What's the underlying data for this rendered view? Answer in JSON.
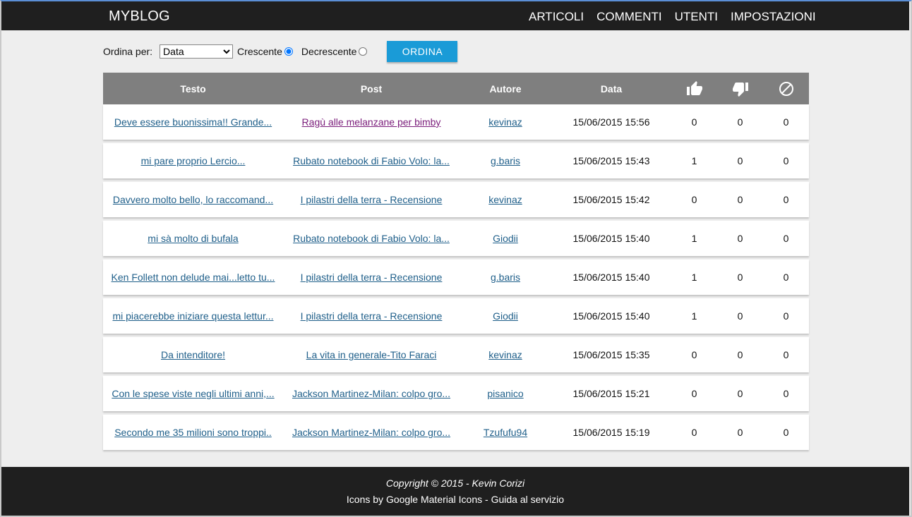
{
  "brand": "MYBLOG",
  "nav": [
    "ARTICOLI",
    "COMMENTI",
    "UTENTI",
    "IMPOSTAZIONI"
  ],
  "toolbar": {
    "order_label": "Ordina per:",
    "order_value": "Data",
    "asc_label": "Crescente",
    "desc_label": "Decrescente",
    "selected": "asc",
    "button": "ORDINA"
  },
  "table": {
    "headers": {
      "text": "Testo",
      "post": "Post",
      "author": "Autore",
      "date": "Data",
      "likes_icon": "thumb-up-icon",
      "dislikes_icon": "thumb-down-icon",
      "blocked_icon": "block-icon"
    },
    "rows": [
      {
        "text": "Deve essere buonissima!! Grande...",
        "post": "Ragù alle melanzane per bimby",
        "author": "kevinaz",
        "date": "15/06/2015 15:56",
        "likes": "0",
        "dislikes": "0",
        "blocked": "0"
      },
      {
        "text": "mi pare proprio Lercio...",
        "post": "Rubato notebook di Fabio Volo: la...",
        "author": "g.baris",
        "date": "15/06/2015 15:43",
        "likes": "1",
        "dislikes": "0",
        "blocked": "0"
      },
      {
        "text": "Davvero molto bello, lo raccomand...",
        "post": "I pilastri della terra - Recensione",
        "author": "kevinaz",
        "date": "15/06/2015 15:42",
        "likes": "0",
        "dislikes": "0",
        "blocked": "0"
      },
      {
        "text": "mi sà molto di bufala",
        "post": "Rubato notebook di Fabio Volo: la...",
        "author": "Giodii",
        "date": "15/06/2015 15:40",
        "likes": "1",
        "dislikes": "0",
        "blocked": "0"
      },
      {
        "text": "Ken Follett non delude mai...letto tu...",
        "post": "I pilastri della terra - Recensione",
        "author": "g.baris",
        "date": "15/06/2015 15:40",
        "likes": "1",
        "dislikes": "0",
        "blocked": "0"
      },
      {
        "text": "mi piacerebbe iniziare questa lettur...",
        "post": "I pilastri della terra - Recensione",
        "author": "Giodii",
        "date": "15/06/2015 15:40",
        "likes": "1",
        "dislikes": "0",
        "blocked": "0"
      },
      {
        "text": "Da intenditore!",
        "post": "La vita in generale-Tito Faraci",
        "author": "kevinaz",
        "date": "15/06/2015 15:35",
        "likes": "0",
        "dislikes": "0",
        "blocked": "0"
      },
      {
        "text": "Con le spese viste negli ultimi anni,...",
        "post": "Jackson Martinez-Milan: colpo gro...",
        "author": "pisanico",
        "date": "15/06/2015 15:21",
        "likes": "0",
        "dislikes": "0",
        "blocked": "0"
      },
      {
        "text": "Secondo me 35 milioni sono troppi..",
        "post": "Jackson Martinez-Milan: colpo gro...",
        "author": "Tzufufu94",
        "date": "15/06/2015 15:19",
        "likes": "0",
        "dislikes": "0",
        "blocked": "0"
      }
    ]
  },
  "footer": {
    "copyright": "Copyright © 2015 - Kevin Corizi",
    "credits": "Icons by Google Material Icons - Guida al servizio"
  },
  "colors": {
    "navbar": "#1f1f1f",
    "accent_button": "#1a9bd7",
    "table_header": "#7f7f7f",
    "link": "#1f5f8a",
    "visited_link": "#7a1c7a"
  }
}
